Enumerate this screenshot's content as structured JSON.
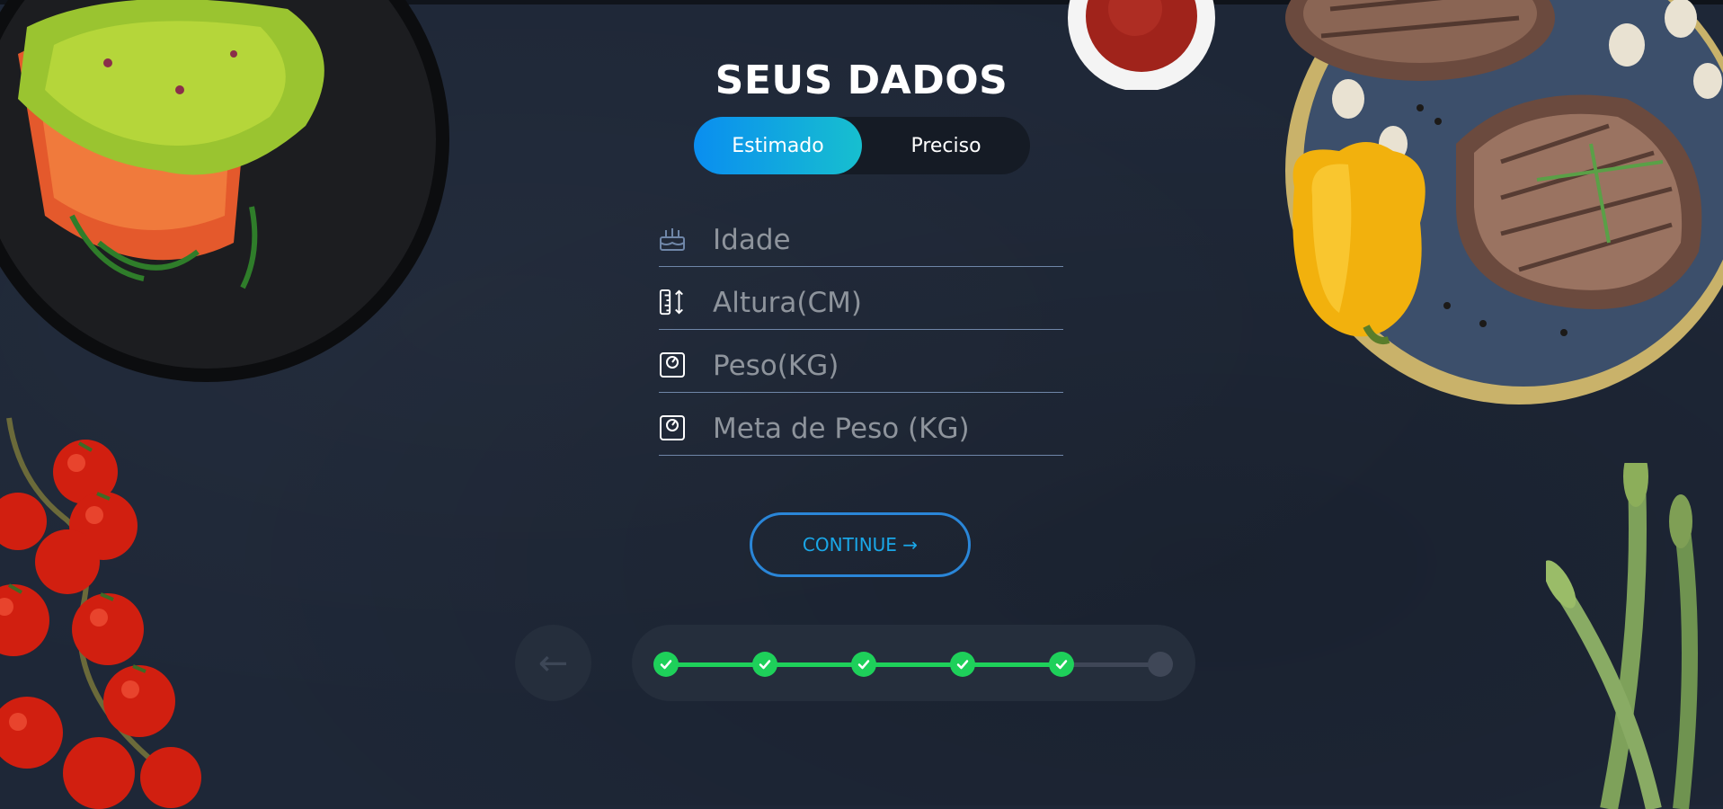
{
  "page": {
    "title": "SEUS DADOS"
  },
  "toggle": {
    "options": [
      {
        "label": "Estimado",
        "active": true
      },
      {
        "label": "Preciso",
        "active": false
      }
    ]
  },
  "form": {
    "fields": [
      {
        "placeholder": "Idade",
        "icon": "birthday-cake-icon",
        "value": ""
      },
      {
        "placeholder": "Altura(CM)",
        "icon": "ruler-height-icon",
        "value": ""
      },
      {
        "placeholder": "Peso(KG)",
        "icon": "scale-icon",
        "value": ""
      },
      {
        "placeholder": "Meta de Peso (KG)",
        "icon": "scale-icon",
        "value": ""
      }
    ],
    "continue_label": "CONTINUE →"
  },
  "navigation": {
    "back_label": "←",
    "progress": {
      "total_steps": 6,
      "completed_steps": 5
    }
  },
  "colors": {
    "background": "#1e2737",
    "accent_blue": "#0a8ef0",
    "accent_cyan": "#17bfcf",
    "progress_green": "#1ed05a",
    "continue_text": "#1aa7e8"
  },
  "decorations": [
    "salmon-guacamole-plate",
    "ketchup-bowl",
    "grilled-steaks-board",
    "yellow-pepper",
    "cherry-tomatoes",
    "asparagus"
  ]
}
